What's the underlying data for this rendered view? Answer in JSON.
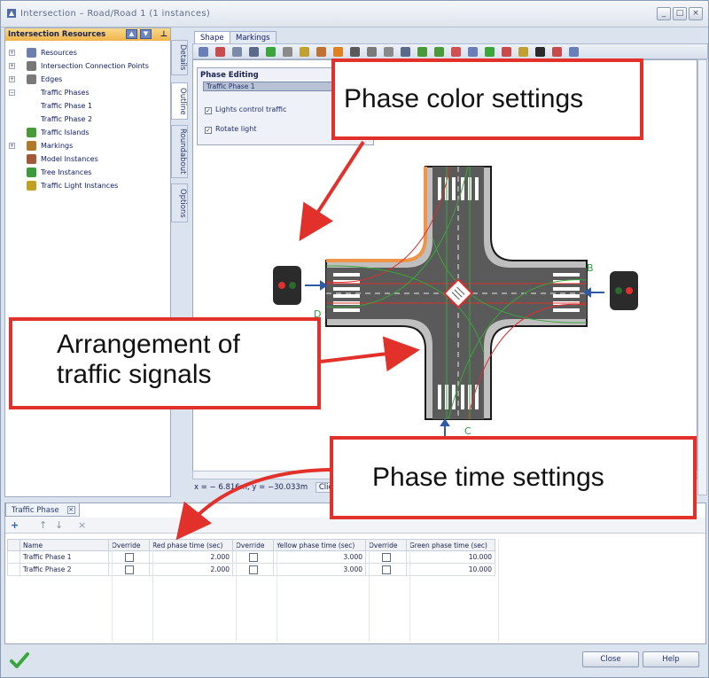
{
  "window": {
    "title": "Intersection – Road/Road 1 (1 instances)",
    "buttons": {
      "minimize": "_",
      "maximize": "□",
      "close": "×"
    }
  },
  "left_panel": {
    "title": "Intersection Resources",
    "tree": [
      {
        "label": "Resources",
        "icon": "database-icon",
        "indent": 0,
        "expander": "+"
      },
      {
        "label": "Intersection Connection Points",
        "icon": "connection-icon",
        "indent": 0,
        "expander": "+"
      },
      {
        "label": "Edges",
        "icon": "edge-icon",
        "indent": 0,
        "expander": "+"
      },
      {
        "label": "Traffic Phases",
        "icon": "",
        "indent": 0,
        "expander": "−"
      },
      {
        "label": "Traffic Phase 1",
        "icon": "",
        "indent": 1,
        "expander": ""
      },
      {
        "label": "Traffic Phase 2",
        "icon": "",
        "indent": 1,
        "expander": ""
      },
      {
        "label": "Traffic Islands",
        "icon": "island-icon",
        "indent": 0,
        "expander": ""
      },
      {
        "label": "Markings",
        "icon": "marking-icon",
        "indent": 0,
        "expander": "+"
      },
      {
        "label": "Model Instances",
        "icon": "model-icon",
        "indent": 0,
        "expander": ""
      },
      {
        "label": "Tree Instances",
        "icon": "tree-icon",
        "indent": 0,
        "expander": ""
      },
      {
        "label": "Traffic Light Instances",
        "icon": "traffic-light-icon",
        "indent": 0,
        "expander": ""
      }
    ]
  },
  "side_tabs": [
    "Details",
    "Outline",
    "Roundabout",
    "Options"
  ],
  "editor": {
    "tabs": [
      "Shape",
      "Markings"
    ],
    "phase_editing": {
      "title": "Phase Editing",
      "selected_phase": "Traffic Phase 1",
      "options": [
        {
          "label": "Lights control traffic",
          "checked": true
        },
        {
          "label": "Rotate light",
          "checked": true
        }
      ]
    },
    "signal_labels": {
      "left": "D",
      "right": "B",
      "bottom": "C"
    },
    "status_coords": "x = − 6.816m, y = −30.033m",
    "status_hint": "Click"
  },
  "bottom_panel": {
    "tab_label": "Traffic Phase",
    "tools": [
      "+",
      "↑",
      "↓",
      "×"
    ],
    "columns": [
      "Name",
      "Override",
      "Red phase time (sec)",
      "Override",
      "Yellow phase time (sec)",
      "Override",
      "Green phase time (sec)"
    ],
    "rows": [
      {
        "name": "Traffic Phase 1",
        "red": "2.000",
        "yellow": "3.000",
        "green": "10.000"
      },
      {
        "name": "Traffic Phase 2",
        "red": "2.000",
        "yellow": "3.000",
        "green": "10.000"
      }
    ]
  },
  "footer": {
    "close_label": "Close",
    "help_label": "Help"
  },
  "callouts": {
    "color": "Phase color settings",
    "arrangement_line1": "Arrangement of",
    "arrangement_line2": "traffic signals",
    "time": "Phase time settings"
  },
  "colors": {
    "callout_border": "#e2312a",
    "panel_header": "#f0b44b",
    "road": "#5a5a5a",
    "phase_green": "#3aa53a",
    "phase_red": "#d83030"
  }
}
